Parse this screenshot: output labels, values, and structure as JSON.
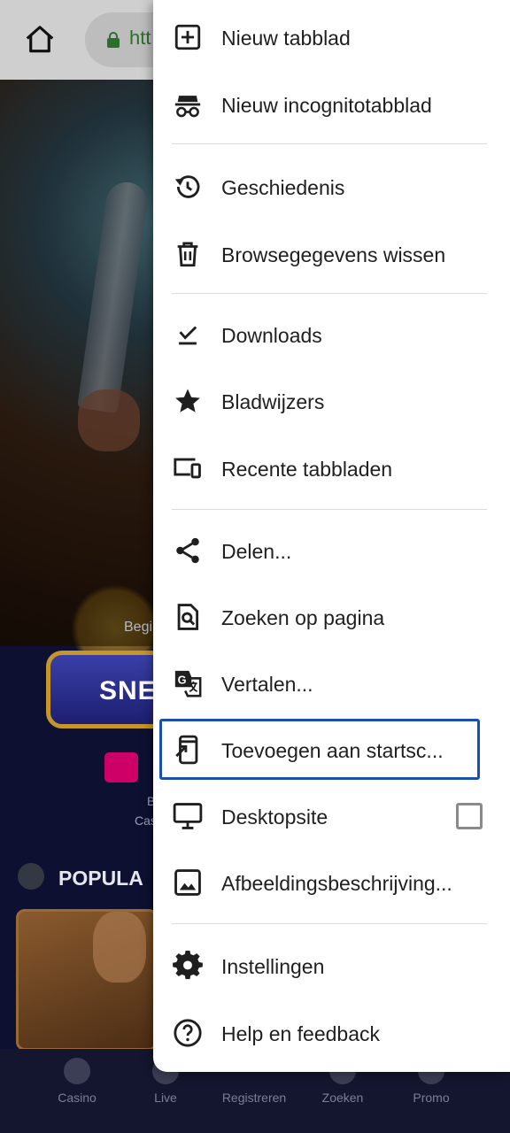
{
  "browser": {
    "url_fragment": "htt"
  },
  "background_page": {
    "intro_text": "Begi",
    "cta_label": "SNE",
    "payment_badge": "iDEAL",
    "payment_text_1": "B",
    "payment_text_2": "Cas",
    "section_title": "POPULA",
    "bottom_nav": [
      "Casino",
      "Live",
      "Registreren",
      "Zoeken",
      "Promo"
    ]
  },
  "menu": {
    "items": [
      {
        "label": "Nieuw tabblad",
        "icon": "new-tab-icon"
      },
      {
        "label": "Nieuw incognitotabblad",
        "icon": "incognito-icon"
      },
      {
        "label": "Geschiedenis",
        "icon": "history-icon"
      },
      {
        "label": "Browsegegevens wissen",
        "icon": "trash-icon"
      },
      {
        "label": "Downloads",
        "icon": "download-icon"
      },
      {
        "label": "Bladwijzers",
        "icon": "star-icon"
      },
      {
        "label": "Recente tabbladen",
        "icon": "devices-icon"
      },
      {
        "label": "Delen...",
        "icon": "share-icon"
      },
      {
        "label": "Zoeken op pagina",
        "icon": "find-in-page-icon"
      },
      {
        "label": "Vertalen...",
        "icon": "translate-icon"
      },
      {
        "label": "Toevoegen aan startsc...",
        "icon": "add-to-home-icon"
      },
      {
        "label": "Desktopsite",
        "icon": "desktop-icon"
      },
      {
        "label": "Afbeeldingsbeschrijving...",
        "icon": "image-icon"
      },
      {
        "label": "Instellingen",
        "icon": "gear-icon"
      },
      {
        "label": "Help en feedback",
        "icon": "help-icon"
      }
    ],
    "desktop_site_checked": false,
    "focused_item": "Toevoegen aan startsc..."
  },
  "colors": {
    "focus_ring": "#1a4fae",
    "lock_green": "#2b6e2e"
  }
}
